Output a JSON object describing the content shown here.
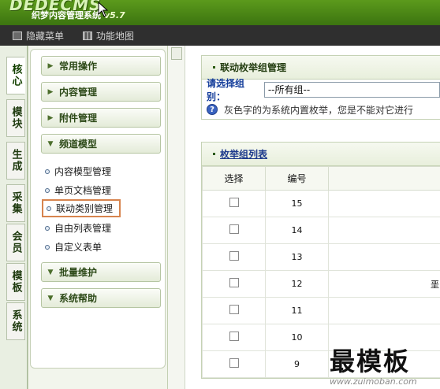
{
  "header": {
    "logo": "DEDECMS",
    "product": "织梦内容管理系统",
    "version": "v5.7"
  },
  "toolbar": {
    "hide_menu": "隐藏菜单",
    "site_map": "功能地图"
  },
  "left_tabs": [
    "核心",
    "模块",
    "生成",
    "采集",
    "会员",
    "模板",
    "系统"
  ],
  "menu": {
    "headers": [
      {
        "label": "常用操作",
        "icon": "chevron-right-icon"
      },
      {
        "label": "内容管理",
        "icon": "chevron-right-icon"
      },
      {
        "label": "附件管理",
        "icon": "chevron-right-icon"
      },
      {
        "label": "频道模型",
        "icon": "chevron-down-icon"
      },
      {
        "label": "批量维护",
        "icon": "chevron-down-icon"
      },
      {
        "label": "系统帮助",
        "icon": "chevron-down-icon"
      }
    ],
    "channel_items": [
      "内容模型管理",
      "单页文档管理",
      "联动类别管理",
      "自由列表管理",
      "自定义表单"
    ]
  },
  "main": {
    "title": "联动枚举组管理",
    "select_label": "请选择组别：",
    "select_value": "--所有组--",
    "info_text": "灰色字的为系统内置枚举，您是不能对它进行",
    "list_title": "枚举组列表",
    "table": {
      "headers": [
        "选择",
        "编号"
      ],
      "rows": [
        {
          "id": "15",
          "extra": ""
        },
        {
          "id": "14",
          "extra": ""
        },
        {
          "id": "13",
          "extra": ""
        },
        {
          "id": "12",
          "extra": "垩"
        },
        {
          "id": "11",
          "extra": ""
        },
        {
          "id": "10",
          "extra": ""
        },
        {
          "id": "9",
          "extra": ""
        }
      ]
    }
  },
  "watermark": {
    "title": "最模板",
    "url": "www.zuimoban.com"
  },
  "colors": {
    "header_green": "#5c9a1c",
    "toolbar_dark": "#2f2f2f",
    "highlight_border": "#d7844e",
    "link_blue": "#1d3a8c"
  }
}
